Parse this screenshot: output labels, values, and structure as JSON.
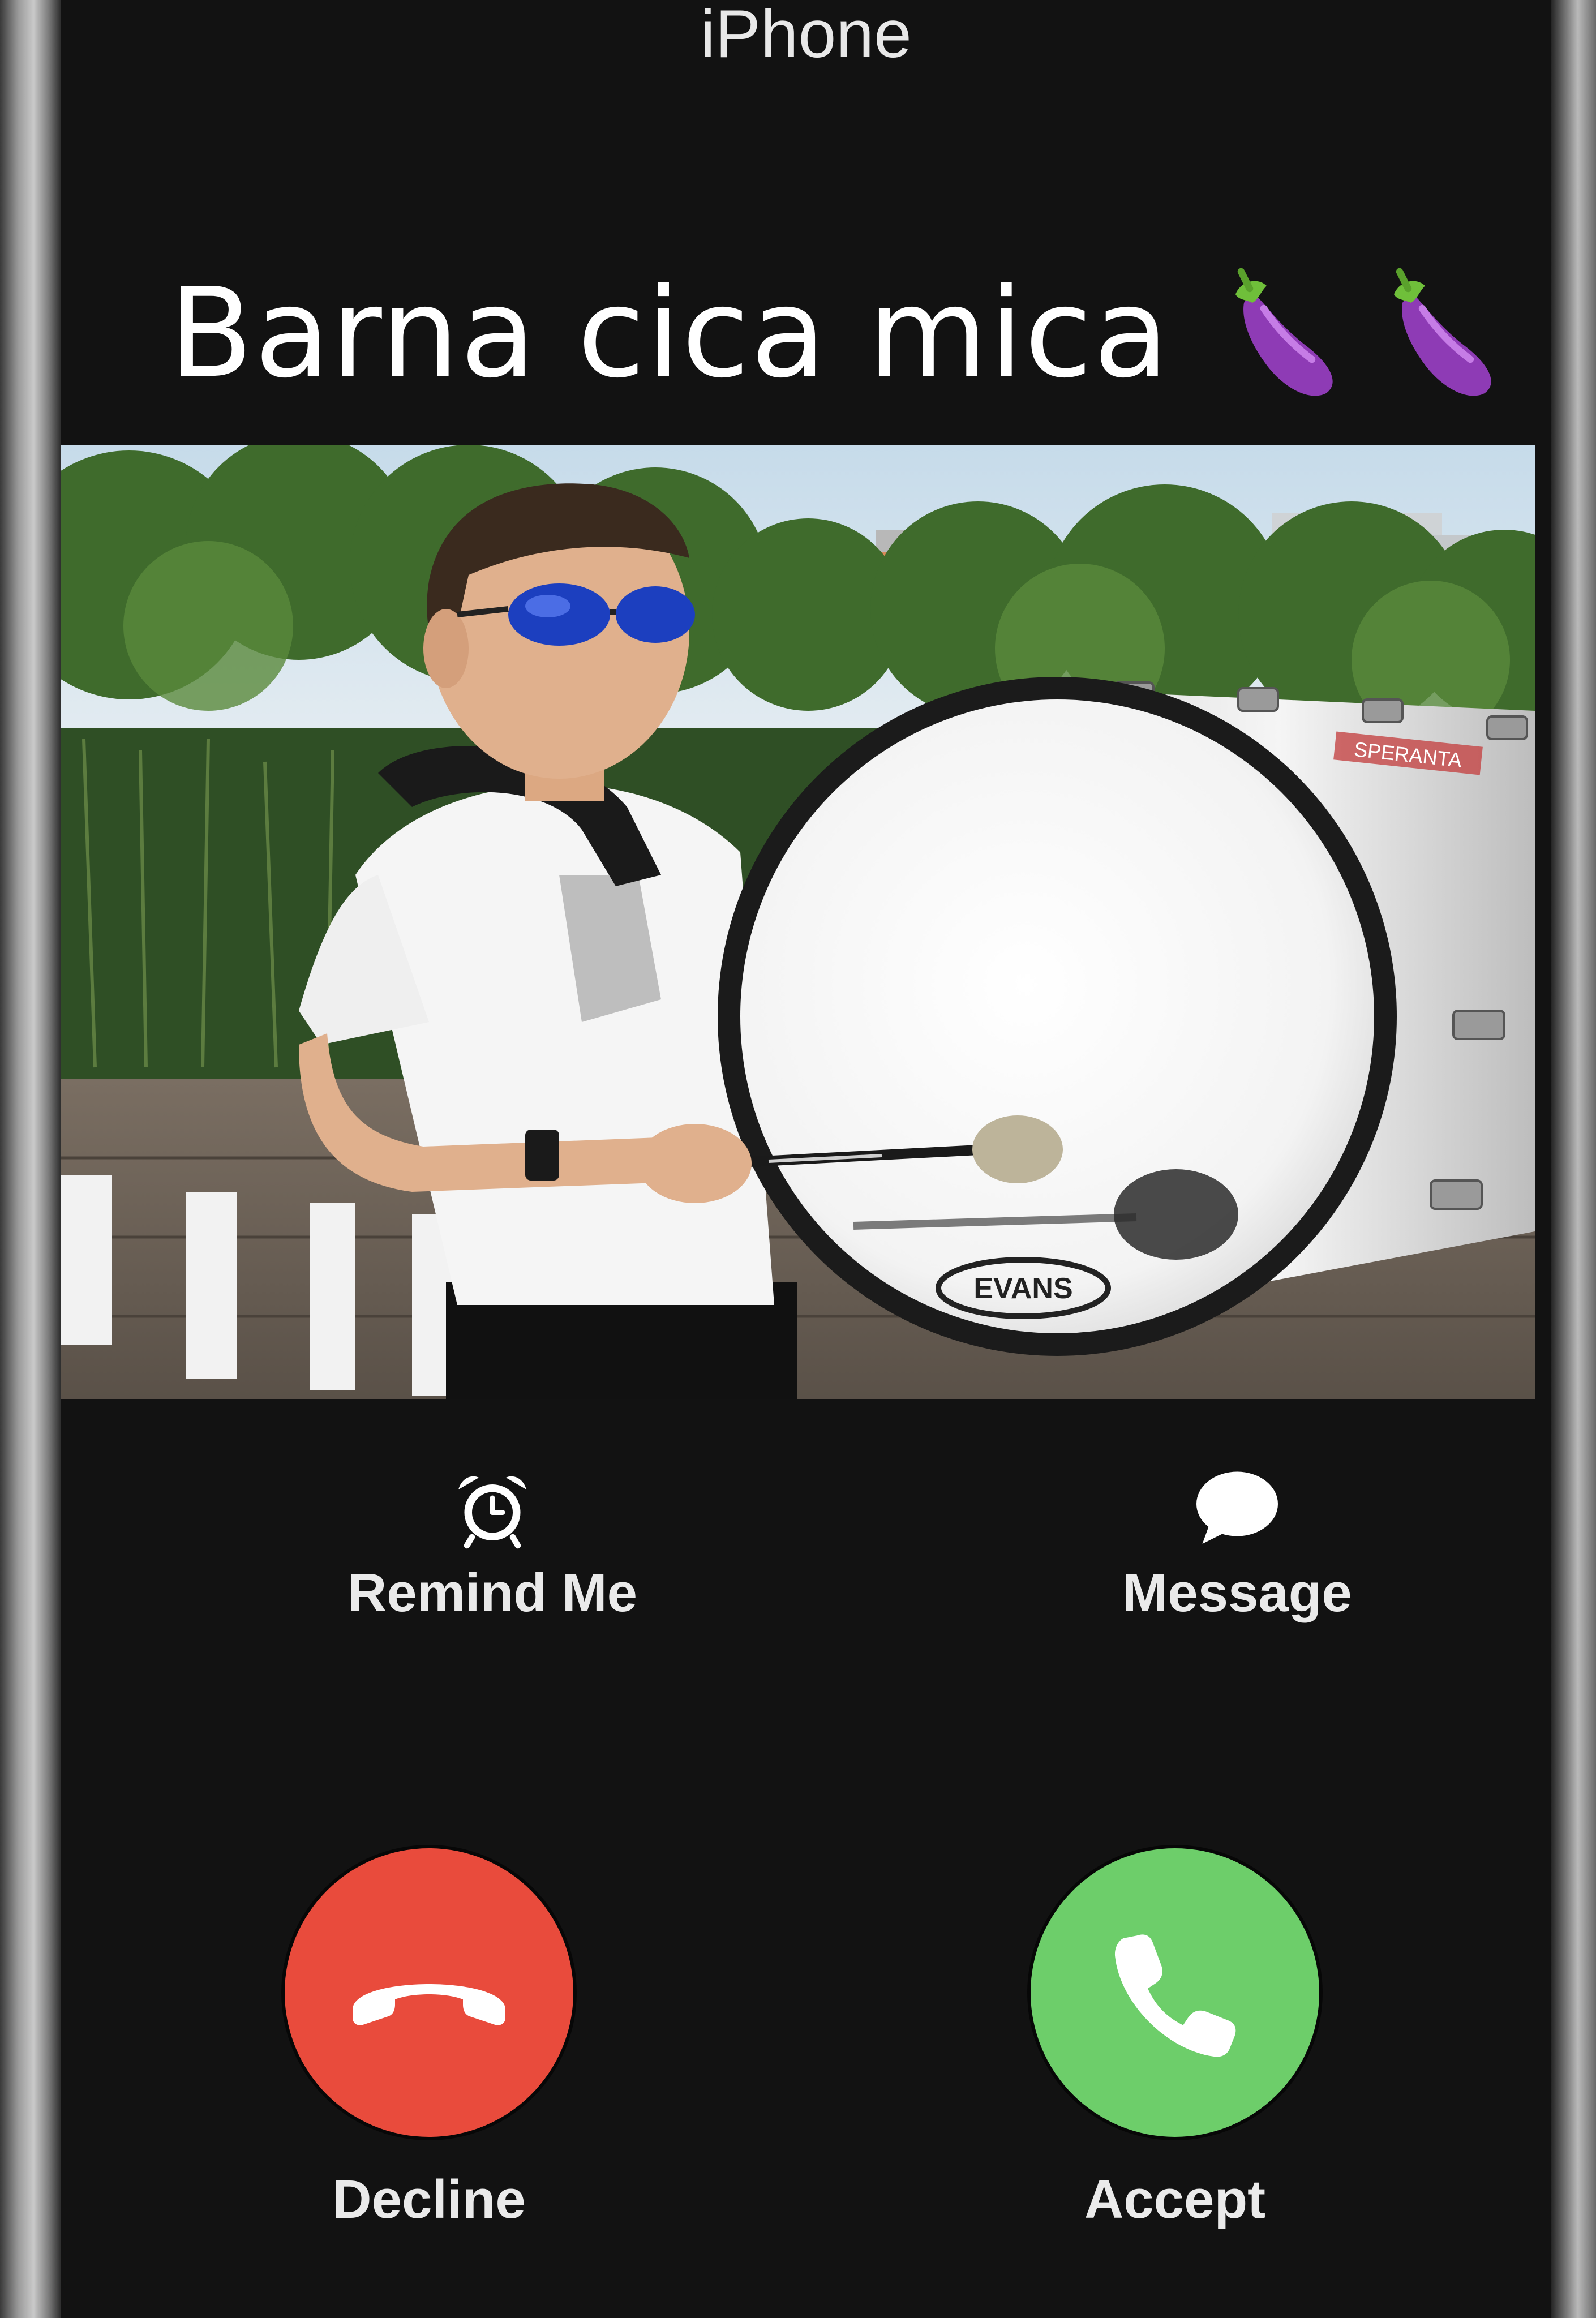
{
  "header": {
    "device_label": "iPhone"
  },
  "caller": {
    "name": "Barna cica mica",
    "emoji_icons": [
      "eggplant-icon",
      "eggplant-icon"
    ]
  },
  "photo": {
    "drum_logo_text": "EVANS",
    "drum_band_text": "SPERANTA"
  },
  "secondary_actions": {
    "remind_label": "Remind Me",
    "message_label": "Message"
  },
  "call_actions": {
    "decline_label": "Decline",
    "accept_label": "Accept",
    "decline_color": "#e94b3c",
    "accept_color": "#6dce6a"
  }
}
